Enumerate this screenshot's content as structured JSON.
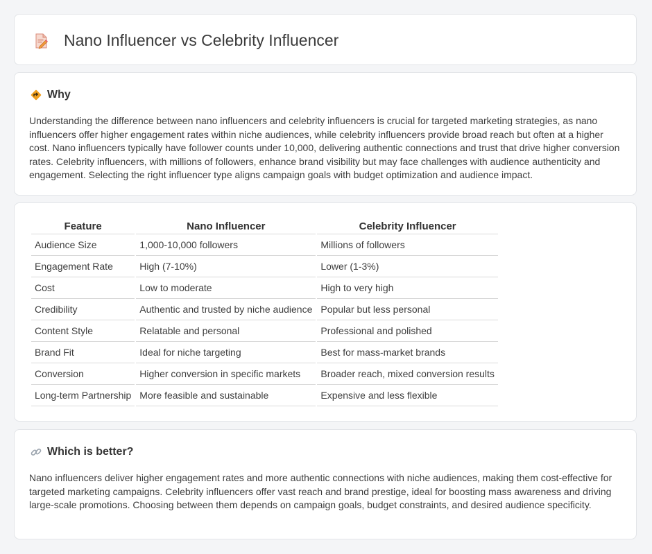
{
  "header": {
    "title": "Nano Influencer vs Celebrity Influencer",
    "icon": "document-edit-icon"
  },
  "why": {
    "heading": "Why",
    "icon": "diamond-direction-icon",
    "text": "Understanding the difference between nano influencers and celebrity influencers is crucial for targeted marketing strategies, as nano influencers offer higher engagement rates within niche audiences, while celebrity influencers provide broad reach but often at a higher cost. Nano influencers typically have follower counts under 10,000, delivering authentic connections and trust that drive higher conversion rates. Celebrity influencers, with millions of followers, enhance brand visibility but may face challenges with audience authenticity and engagement. Selecting the right influencer type aligns campaign goals with budget optimization and audience impact."
  },
  "comparison": {
    "headers": [
      "Feature",
      "Nano Influencer",
      "Celebrity Influencer"
    ],
    "rows": [
      [
        "Audience Size",
        "1,000-10,000 followers",
        "Millions of followers"
      ],
      [
        "Engagement Rate",
        "High (7-10%)",
        "Lower (1-3%)"
      ],
      [
        "Cost",
        "Low to moderate",
        "High to very high"
      ],
      [
        "Credibility",
        "Authentic and trusted by niche audience",
        "Popular but less personal"
      ],
      [
        "Content Style",
        "Relatable and personal",
        "Professional and polished"
      ],
      [
        "Brand Fit",
        "Ideal for niche targeting",
        "Best for mass-market brands"
      ],
      [
        "Conversion",
        "Higher conversion in specific markets",
        "Broader reach, mixed conversion results"
      ],
      [
        "Long-term Partnership",
        "More feasible and sustainable",
        "Expensive and less flexible"
      ]
    ]
  },
  "better": {
    "heading": "Which is better?",
    "icon": "link-icon",
    "text": "Nano influencers deliver higher engagement rates and more authentic connections with niche audiences, making them cost-effective for targeted marketing campaigns. Celebrity influencers offer vast reach and brand prestige, ideal for boosting mass awareness and driving large-scale promotions. Choosing between them depends on campaign goals, budget constraints, and desired audience specificity."
  },
  "colors": {
    "background": "#f4f5f7",
    "card": "#ffffff",
    "border": "#e2e4e8",
    "icon_orange": "#f0a020",
    "icon_pink": "#e8607a"
  }
}
